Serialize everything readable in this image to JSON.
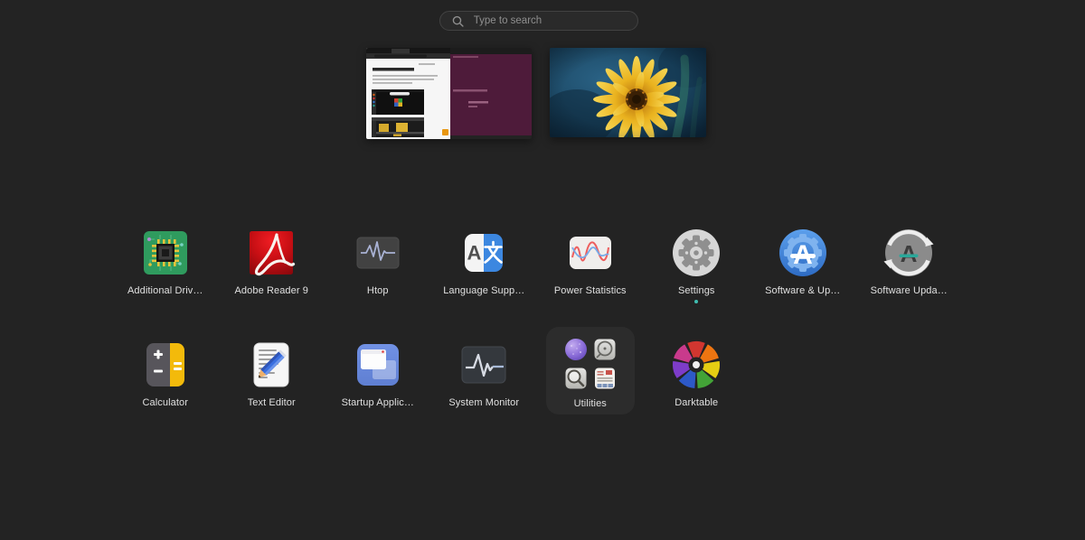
{
  "colors": {
    "background": "#232323",
    "label": "#e0e0e0",
    "running_dot": "#3fbdb0",
    "search_background": "#2a2a2a",
    "search_text": "#8f8f8f",
    "folder_background": "#2c2c2c",
    "accent_blue": "#3584e4"
  },
  "search": {
    "placeholder": "Type to search",
    "icon": "search-icon"
  },
  "window_thumbnails": [
    {
      "name": "browser-and-terminal-window"
    },
    {
      "name": "flower-photo-window"
    }
  ],
  "apps": [
    {
      "label": "Additional Driv…",
      "icon": "additional-drivers-icon"
    },
    {
      "label": "Adobe Reader 9",
      "icon": "adobe-reader-icon"
    },
    {
      "label": "Htop",
      "icon": "htop-icon"
    },
    {
      "label": "Language Supp…",
      "icon": "language-support-icon"
    },
    {
      "label": "Power Statistics",
      "icon": "power-statistics-icon"
    },
    {
      "label": "Settings",
      "icon": "settings-icon",
      "running": true
    },
    {
      "label": "Software & Up…",
      "icon": "software-and-updates-icon"
    },
    {
      "label": "Software Upda…",
      "icon": "software-updater-icon"
    },
    {
      "label": "Calculator",
      "icon": "calculator-icon"
    },
    {
      "label": "Text Editor",
      "icon": "text-editor-icon"
    },
    {
      "label": "Startup Applic…",
      "icon": "startup-applications-icon"
    },
    {
      "label": "System Monitor",
      "icon": "system-monitor-icon"
    },
    {
      "label": "Utilities",
      "icon": "utilities-folder-icon",
      "folder": true
    },
    {
      "label": "Darktable",
      "icon": "darktable-icon"
    }
  ]
}
